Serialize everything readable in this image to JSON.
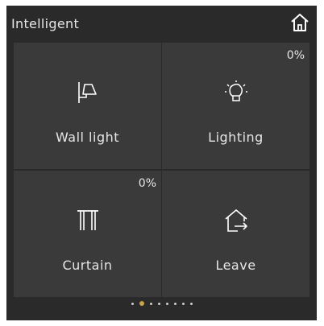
{
  "header": {
    "title": "Intelligent",
    "home_icon": "home-icon"
  },
  "tiles": [
    {
      "label": "Wall light",
      "icon": "wall-light-icon",
      "percent": ""
    },
    {
      "label": "Lighting",
      "icon": "bulb-icon",
      "percent": "0%"
    },
    {
      "label": "Curtain",
      "icon": "curtain-icon",
      "percent": "0%"
    },
    {
      "label": "Leave",
      "icon": "leave-home-icon",
      "percent": ""
    }
  ],
  "pager": {
    "count": 8,
    "active_index": 1,
    "active_color": "#c8a24a"
  },
  "colors": {
    "panel": "#2a2a2a",
    "tile": "#3a3a3a",
    "text": "#e6e6e6"
  }
}
